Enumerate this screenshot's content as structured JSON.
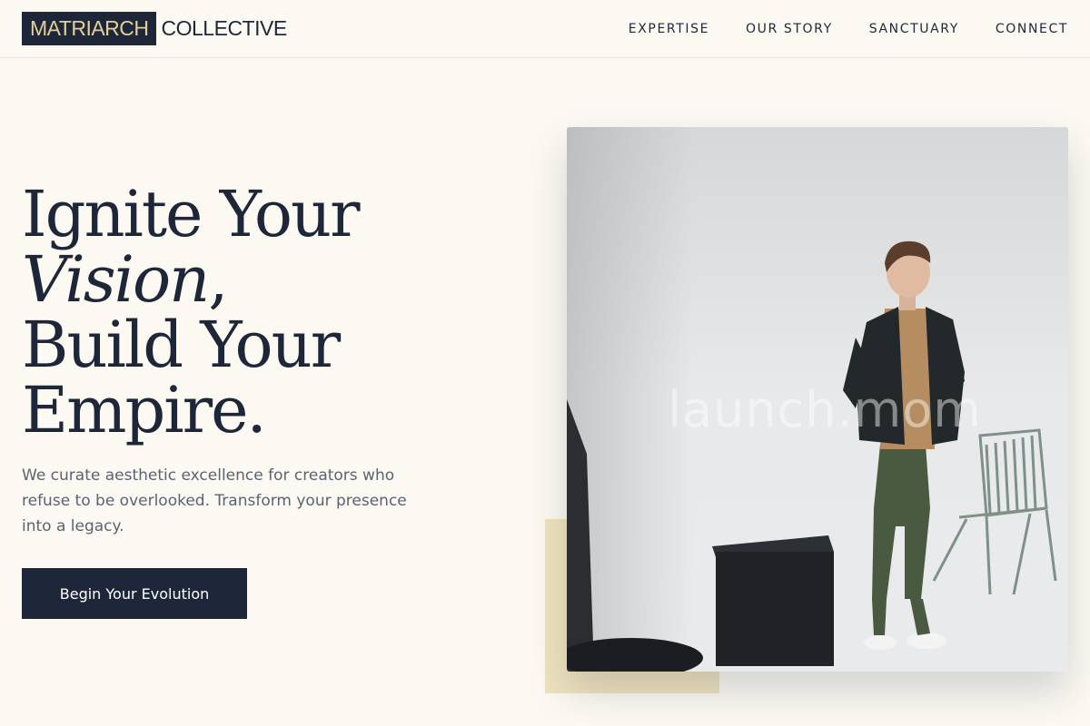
{
  "brand": {
    "name_highlight": "MATRIARCH",
    "name_rest": "COLLECTIVE",
    "highlight_bg": "#1e2739",
    "highlight_fg": "#e3cf98"
  },
  "nav": {
    "items": [
      "EXPERTISE",
      "OUR STORY",
      "SANCTUARY",
      "CONNECT"
    ]
  },
  "hero": {
    "line1": "Ignite Your",
    "line2_italic": "Vision",
    "line2_tail": ",",
    "line3": "Build Your",
    "line4": "Empire.",
    "subtitle": "We curate aesthetic excellence for creators who refuse to be overlooked. Transform your presence into a legacy.",
    "cta_label": "Begin Your Evolution"
  },
  "image": {
    "watermark": "launch.mom",
    "subject": "man in dark blazer standing beside a chair and black cube in a white studio"
  },
  "colors": {
    "background": "#fcf9f2",
    "navy": "#1e2739",
    "gold_accent": "#efe3bf",
    "muted_text": "#5b6272"
  }
}
